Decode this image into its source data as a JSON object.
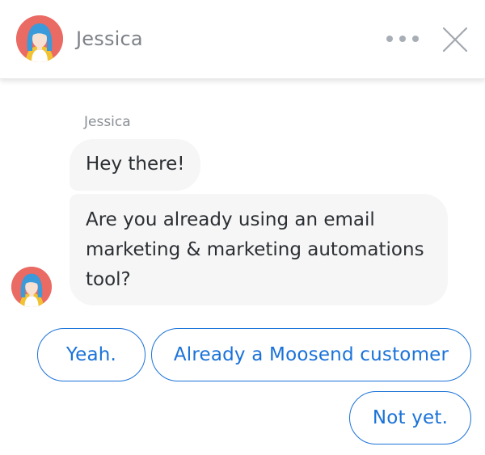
{
  "header": {
    "name": "Jessica",
    "avatar_icon": "woman-avatar-icon",
    "more_icon": "more-dots-icon",
    "close_icon": "close-icon"
  },
  "conversation": {
    "sender": "Jessica",
    "messages": [
      "Hey there!",
      "Are you already using an email marketing & marketing automations tool?"
    ]
  },
  "quick_replies": [
    "Yeah.",
    "Already a Moosend customer",
    "Not yet."
  ],
  "colors": {
    "accent": "#1a72d8",
    "avatar_bg": "#ea6a64",
    "bubble_bg": "#f6f6f6",
    "muted_text": "#7e8288"
  }
}
